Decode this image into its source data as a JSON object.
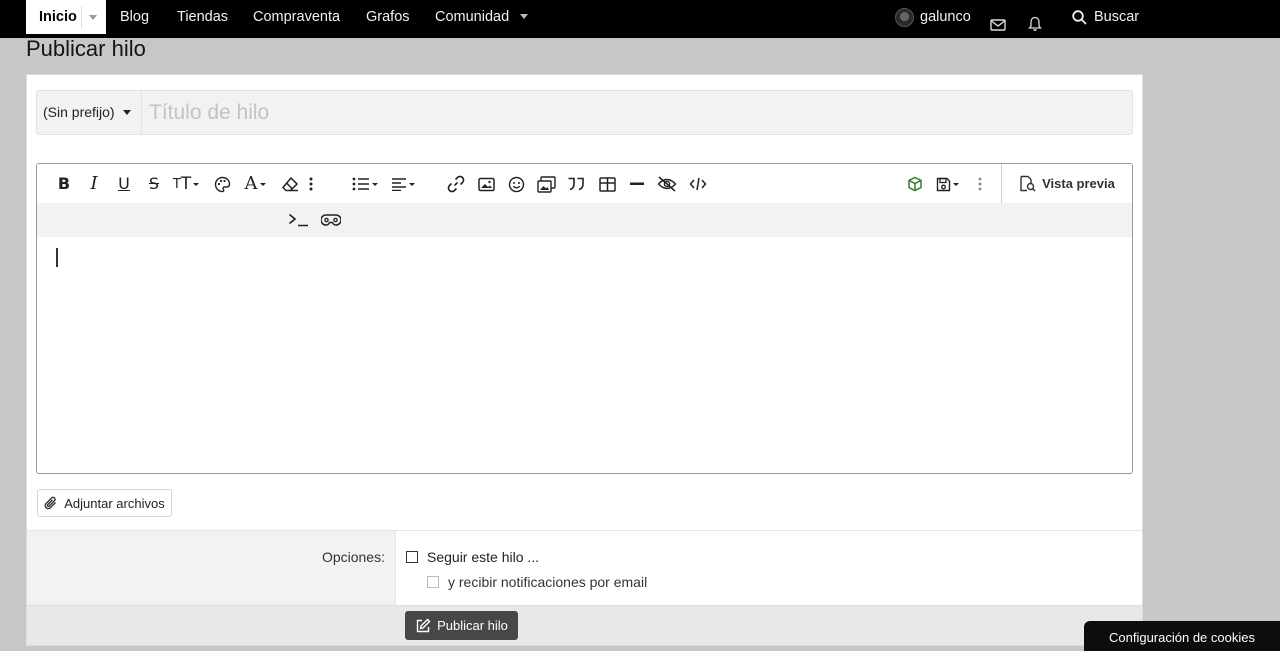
{
  "nav": {
    "home": "Inicio",
    "items": [
      "Blog",
      "Tiendas",
      "Compraventa",
      "Grafos",
      "Comunidad"
    ],
    "username": "galunco",
    "search": "Buscar"
  },
  "page": {
    "title": "Publicar hilo"
  },
  "form": {
    "prefix": "(Sin prefijo)",
    "title_placeholder": "Título de hilo",
    "preview_label": "Vista previa",
    "attach_label": "Adjuntar archivos",
    "options_label": "Opciones:",
    "follow_label": "Seguir este hilo ...",
    "email_label": "y recibir notificaciones por email",
    "submit_label": "Publicar hilo"
  },
  "toolbar": {
    "buttons": [
      "bold-icon",
      "italic-icon",
      "underline-icon",
      "strikethrough-icon",
      "font-size-icon",
      "palette-icon",
      "font-family-icon",
      "eraser-icon",
      "more-vertical-icon",
      "list-icon",
      "align-icon",
      "link-icon",
      "image-icon",
      "smiley-icon",
      "media-icon",
      "quote-icon",
      "table-icon",
      "horizontal-line-icon",
      "hidden-icon",
      "code-icon",
      "cube-icon",
      "save-drafts-icon",
      "more-options-icon",
      "terminal-icon",
      "gamepad-icon"
    ]
  },
  "cookie_banner": "Configuración de cookies"
}
